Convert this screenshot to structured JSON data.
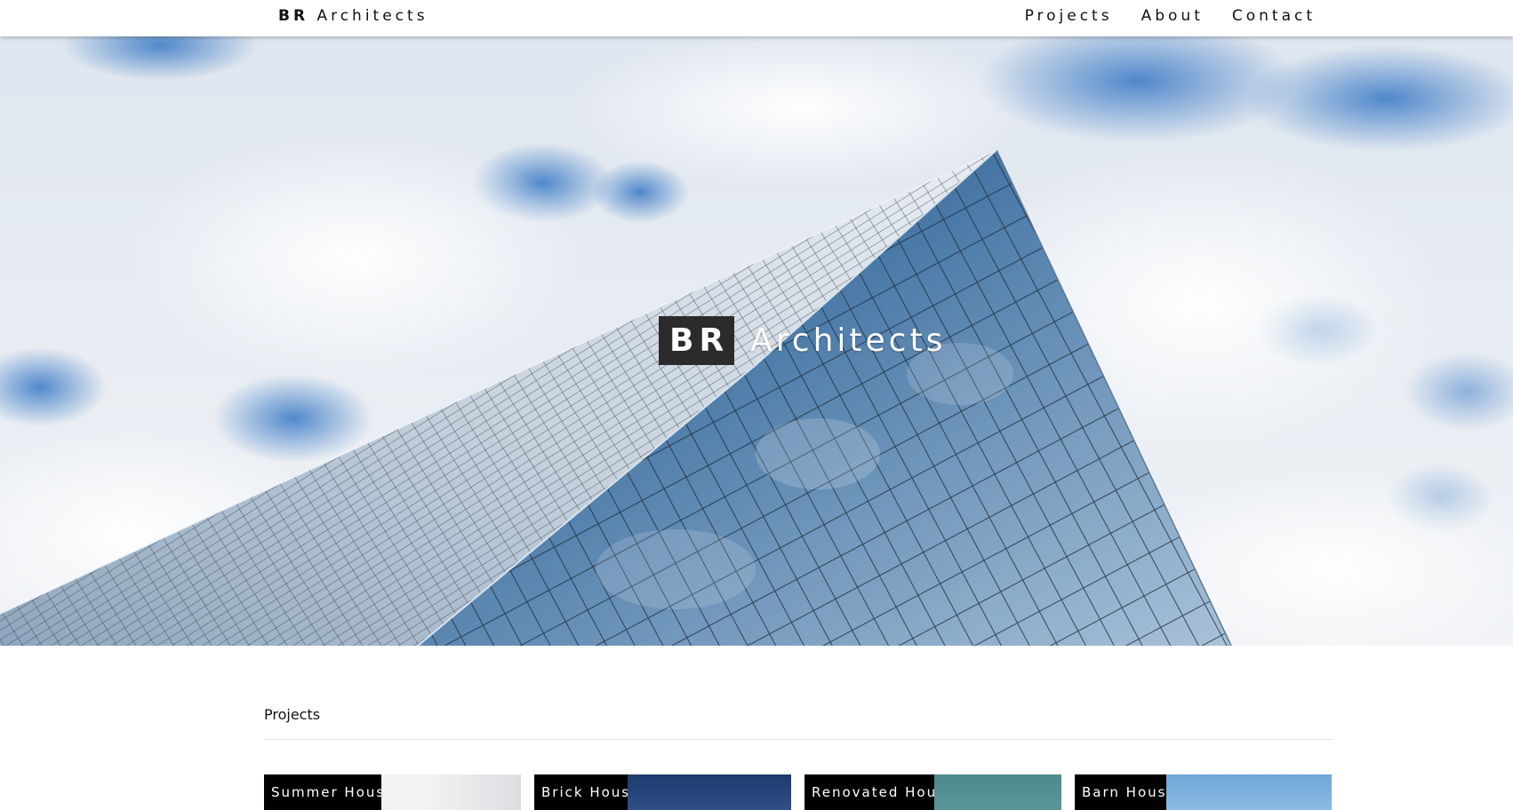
{
  "header": {
    "brand_bold": "BR",
    "brand_rest": "Architects",
    "nav": [
      "Projects",
      "About",
      "Contact"
    ]
  },
  "hero": {
    "title_box": "BR",
    "title_rest": "Architects",
    "image": "glass-skyscraper-against-cloudy-sky"
  },
  "projects": {
    "heading": "Projects",
    "cards": [
      {
        "label": "Summer House",
        "image": "minimal-white-house-photo"
      },
      {
        "label": "Brick House",
        "image": "night-sky-house-photo"
      },
      {
        "label": "Renovated House",
        "image": "teal-sky-house-photo"
      },
      {
        "label": "Barn House",
        "image": "blue-sky-trees-photo"
      }
    ]
  },
  "colors": {
    "nav_text": "#111111",
    "title_box_bg": "#2b2b2b",
    "card_label_bg": "#000000",
    "sky_blue": "#3e7cc6"
  }
}
